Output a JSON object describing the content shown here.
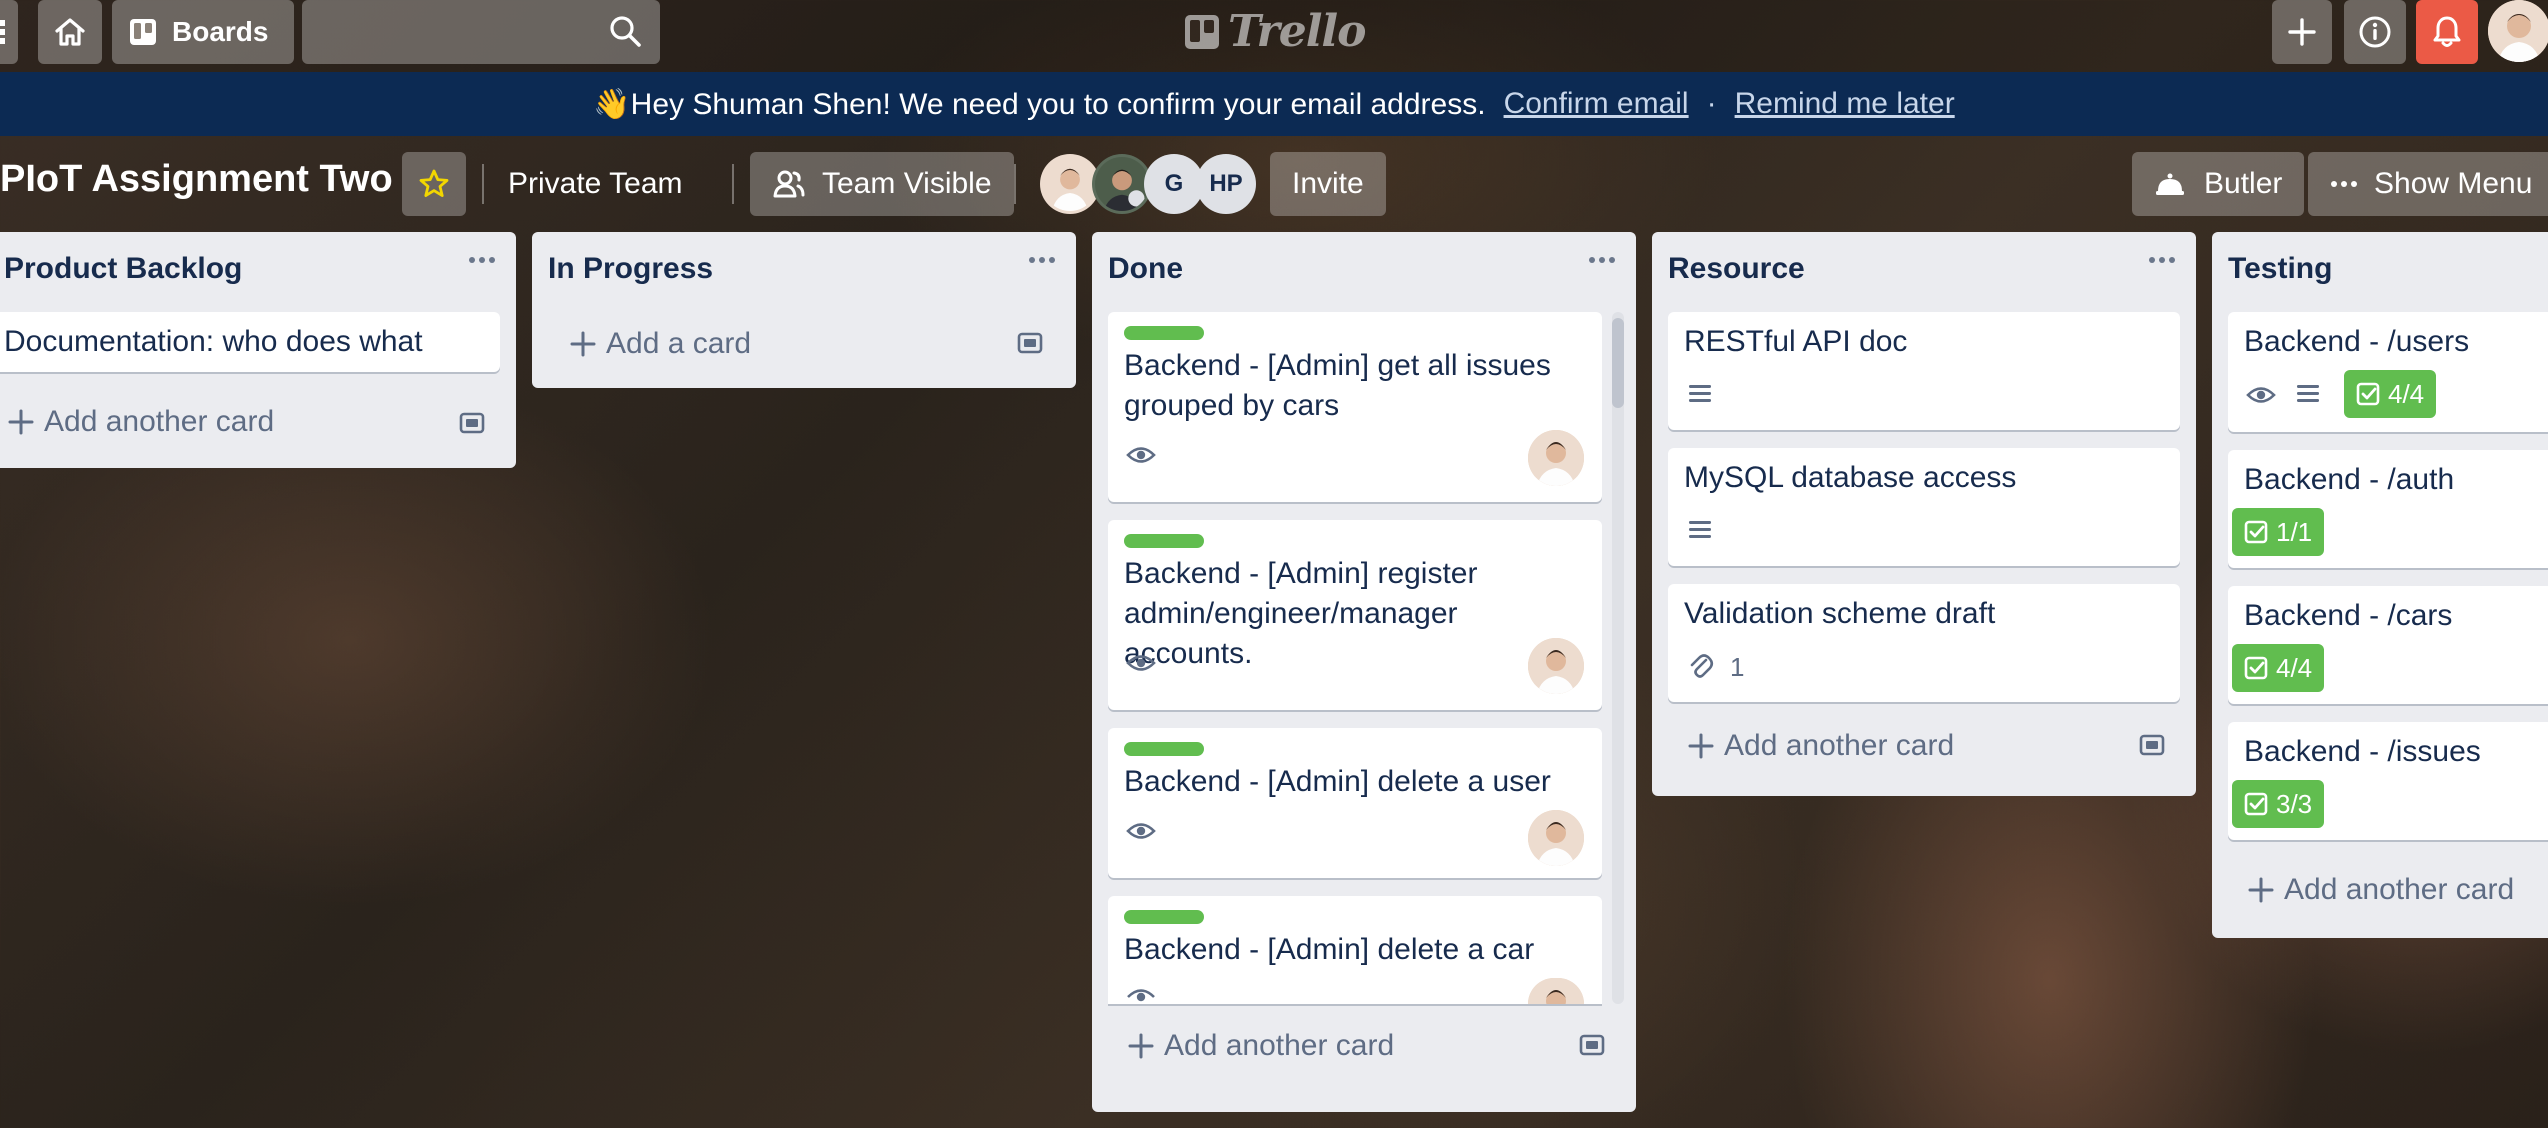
{
  "nav": {
    "boards_label": "Boards",
    "logo_text": "Trello",
    "search_placeholder": ""
  },
  "banner": {
    "message": "👋Hey Shuman Shen! We need you to confirm your email address.",
    "confirm_link": "Confirm email",
    "separator": "·",
    "remind_link": "Remind me later"
  },
  "board": {
    "title": "PIoT Assignment Two",
    "team": "Private Team",
    "visibility": "Team Visible",
    "members": [
      {
        "initials": ""
      },
      {
        "initials": ""
      },
      {
        "initials": "G"
      },
      {
        "initials": "HP"
      }
    ],
    "invite_label": "Invite",
    "butler_label": "Butler",
    "show_menu_label": "Show Menu"
  },
  "lists": [
    {
      "title": "Product Backlog",
      "cards": [
        {
          "title": "Documentation: who does what"
        }
      ],
      "add_label": "Add another card"
    },
    {
      "title": "In Progress",
      "cards": [],
      "add_label": "Add a card"
    },
    {
      "title": "Done",
      "cards": [
        {
          "title": "Backend - [Admin] get all issues grouped by cars",
          "label_color": "#61bd4f"
        },
        {
          "title": "Backend - [Admin] register admin/engineer/manager accounts.",
          "label_color": "#61bd4f"
        },
        {
          "title": "Backend - [Admin] delete a user",
          "label_color": "#61bd4f"
        },
        {
          "title": "Backend - [Admin] delete a car",
          "label_color": "#61bd4f"
        }
      ],
      "add_label": "Add another card"
    },
    {
      "title": "Resource",
      "cards": [
        {
          "title": "RESTful API doc"
        },
        {
          "title": "MySQL database access"
        },
        {
          "title": "Validation scheme draft",
          "attachments": "1"
        }
      ],
      "add_label": "Add another card"
    },
    {
      "title": "Testing",
      "cards": [
        {
          "title": "Backend - /users",
          "checklist": "4/4"
        },
        {
          "title": "Backend - /auth",
          "checklist": "1/1"
        },
        {
          "title": "Backend - /cars",
          "checklist": "4/4"
        },
        {
          "title": "Backend - /issues",
          "checklist": "3/3"
        }
      ],
      "add_label": "Add another card"
    }
  ],
  "colors": {
    "banner_bg": "#0c2a53",
    "label_green": "#61bd4f",
    "bell_red": "#eb5a46",
    "list_bg": "#ebecf0",
    "text": "#172b4d"
  }
}
